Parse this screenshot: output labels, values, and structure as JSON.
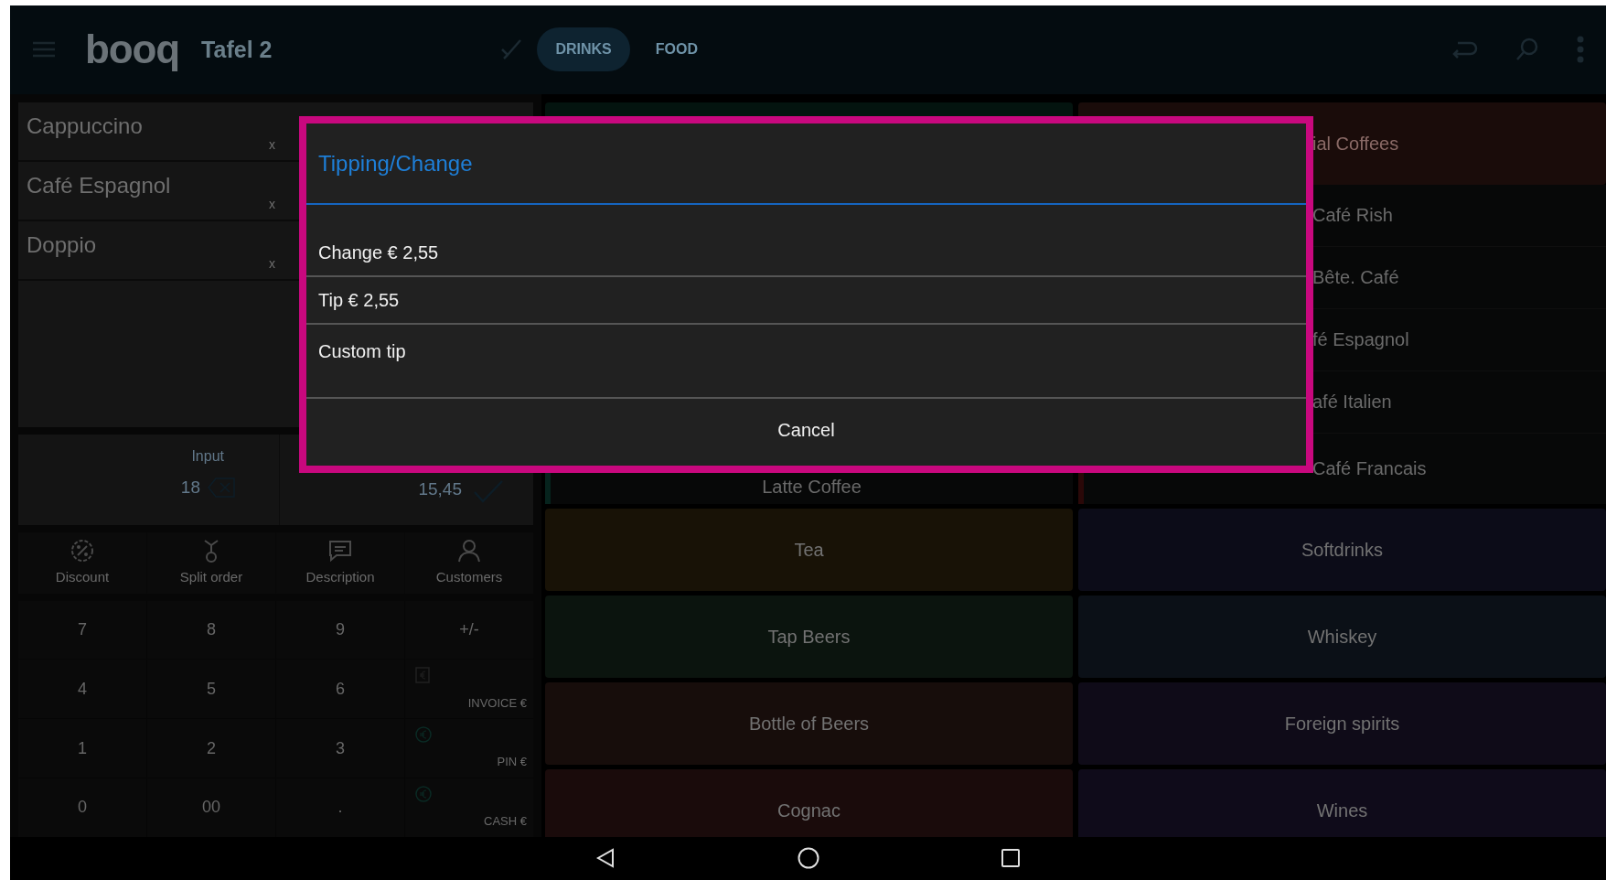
{
  "top_bar": {
    "logo": "booq",
    "title": "Tafel 2",
    "tabs": [
      {
        "label": "DRINKS",
        "selected": true
      },
      {
        "label": "FOOD",
        "selected": false
      }
    ]
  },
  "order": {
    "items": [
      {
        "name": "Cappuccino",
        "qty": "x"
      },
      {
        "name": "Café Espagnol",
        "qty": "x"
      },
      {
        "name": "Doppio",
        "qty": "x"
      }
    ]
  },
  "input": {
    "label": "Input",
    "value": "18",
    "total": "15,45"
  },
  "actions": [
    {
      "label": "Discount",
      "kind": "discount"
    },
    {
      "label": "Split order",
      "kind": "split"
    },
    {
      "label": "Description",
      "kind": "description"
    },
    {
      "label": "Customers",
      "kind": "customers"
    }
  ],
  "keypad": {
    "keys": [
      "7",
      "8",
      "9",
      "4",
      "5",
      "6",
      "1",
      "2",
      "3",
      "0",
      "00",
      "."
    ],
    "side": [
      {
        "label": "+/-",
        "kind": "plain"
      },
      {
        "label": "INVOICE €",
        "kind": "invoice"
      },
      {
        "label": "PIN €",
        "kind": "pin"
      },
      {
        "label": "CASH €",
        "kind": "cash"
      }
    ]
  },
  "products": {
    "left_items": [
      "Latte Coffee"
    ],
    "right_header": "ial Coffees",
    "right_items": [
      "Café Rish",
      "Bête. Café",
      "fé Espagnol",
      "afé Italien",
      "Café Francais"
    ]
  },
  "categories": [
    {
      "label": "Tea",
      "color": "#181206"
    },
    {
      "label": "Softdrinks",
      "color": "#0c0c18"
    },
    {
      "label": "Tap Beers",
      "color": "#0b140e"
    },
    {
      "label": "Whiskey",
      "color": "#0b1017"
    },
    {
      "label": "Bottle of Beers",
      "color": "#170d0b"
    },
    {
      "label": "Foreign spirits",
      "color": "#0f0b18"
    },
    {
      "label": "Cognac",
      "color": "#1a0b0b"
    },
    {
      "label": "Wines",
      "color": "#0f0b1a"
    }
  ],
  "dialog": {
    "title": "Tipping/Change",
    "options": [
      "Change € 2,55",
      "Tip € 2,55",
      "Custom tip"
    ],
    "cancel": "Cancel"
  }
}
